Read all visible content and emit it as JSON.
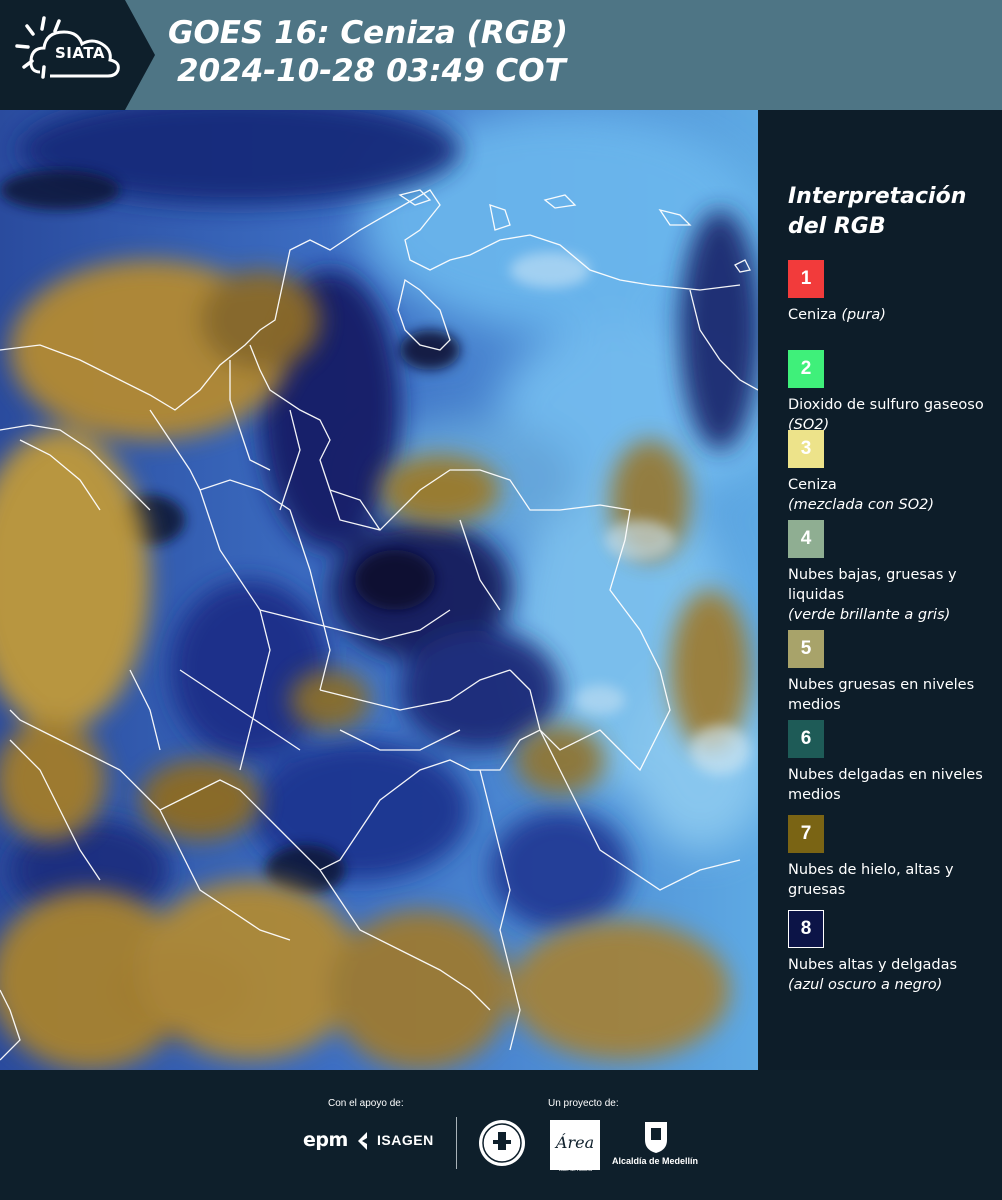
{
  "header": {
    "logo_text": "SIATA",
    "title_line1": "GOES 16: Ceniza (RGB)",
    "title_line2": "2024-10-28 03:49 COT"
  },
  "map": {
    "base_colors": {
      "ocean_light": "#5fa7e0",
      "cloud_blue": "#2b4aa3",
      "cloud_dark": "#0f1640",
      "cloud_ochre": "#b78a2f",
      "border_line": "#ffffff"
    }
  },
  "legend": {
    "title_line1": "Interpretación",
    "title_line2": "del RGB",
    "items": [
      {
        "number": "1",
        "color": "#f23b3b",
        "text": "Ceniza",
        "note": "(pura)",
        "note_block": ""
      },
      {
        "number": "2",
        "color": "#3ff07a",
        "text": "Dioxido de sulfuro gaseoso",
        "note": "(SO2)",
        "note_block": ""
      },
      {
        "number": "3",
        "color": "#ede38a",
        "text": "Ceniza",
        "note": "",
        "note_block": "(mezclada con SO2)"
      },
      {
        "number": "4",
        "color": "#8fae92",
        "text": "Nubes bajas, gruesas y liquidas",
        "note": "",
        "note_block": "(verde brillante a gris)"
      },
      {
        "number": "5",
        "color": "#a8a36a",
        "text": "Nubes gruesas en niveles medios",
        "note": "",
        "note_block": ""
      },
      {
        "number": "6",
        "color": "#1e5b57",
        "text": "Nubes delgadas en niveles medios",
        "note": "",
        "note_block": ""
      },
      {
        "number": "7",
        "color": "#7a6414",
        "text": "Nubes de hielo, altas y gruesas",
        "note": "",
        "note_block": ""
      },
      {
        "number": "8",
        "color": "#0c1447",
        "text": "Nubes altas y delgadas",
        "note": "",
        "note_block": "(azul oscuro a negro)"
      }
    ]
  },
  "footer": {
    "support_label": "Con el apoyo de:",
    "project_label": "Un proyecto de:",
    "epm": "epm",
    "isagen": "ISAGEN",
    "area_text": "METROPOLITANA Valle de Aburrá",
    "area_script": "Área",
    "medellin_text": "Alcaldía de Medellín"
  }
}
